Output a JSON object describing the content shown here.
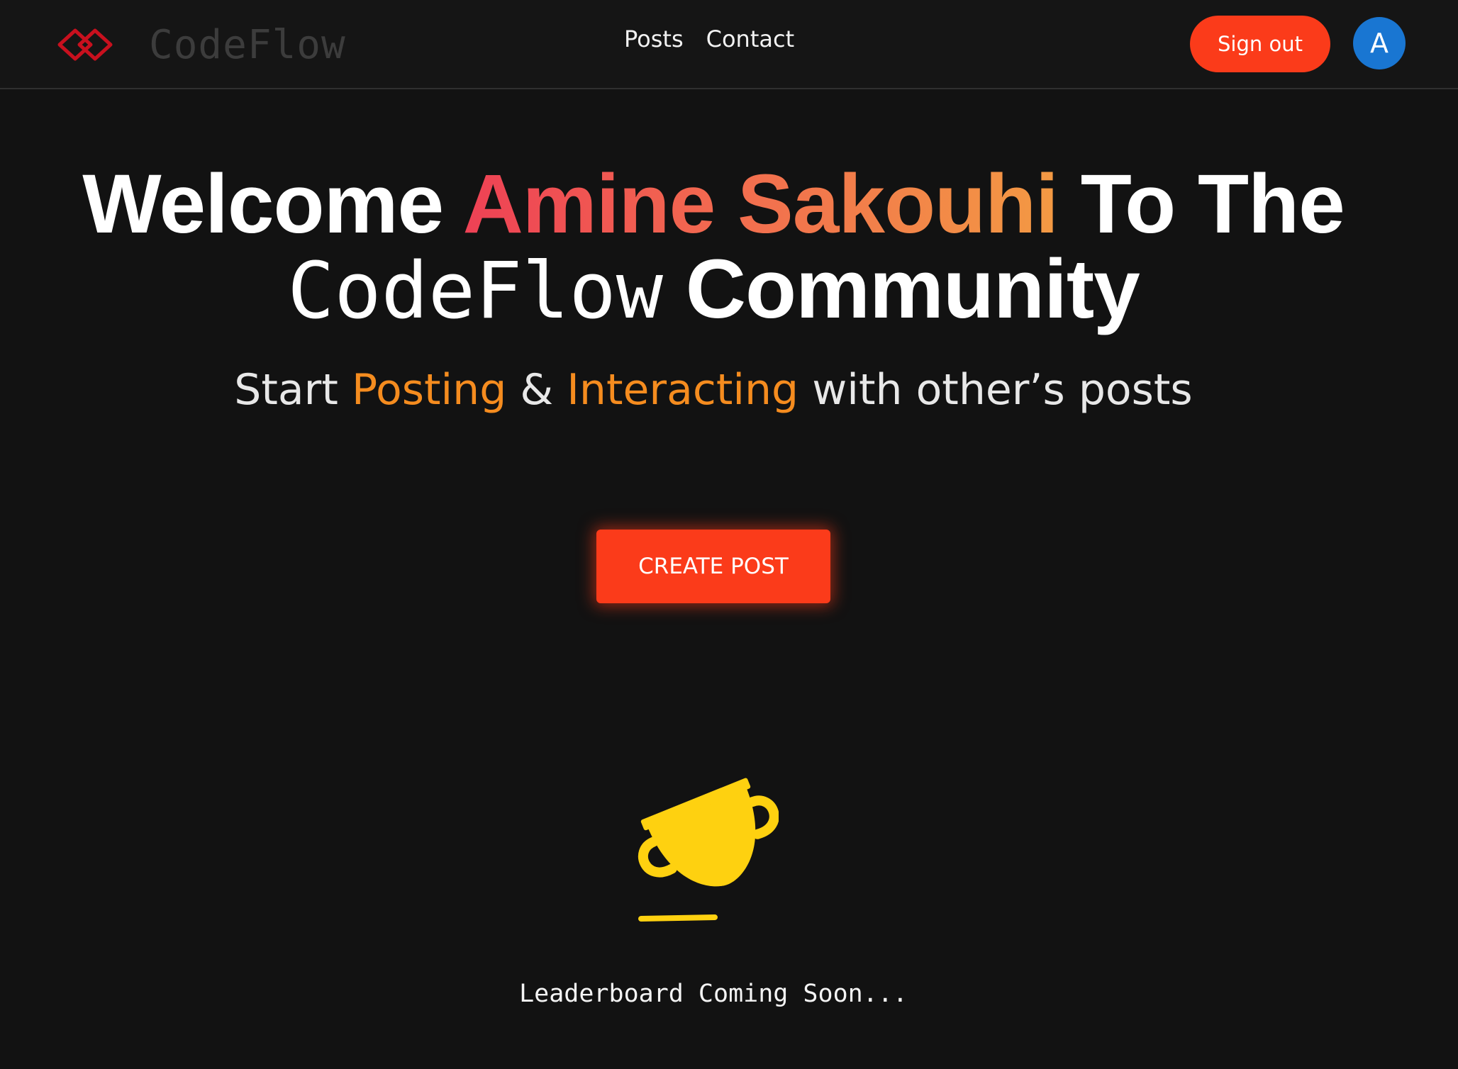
{
  "navbar": {
    "brand_name": "CodeFlow",
    "links": [
      {
        "label": "Posts"
      },
      {
        "label": "Contact"
      }
    ],
    "signout_label": "Sign out",
    "avatar_initial": "A"
  },
  "hero": {
    "welcome": "Welcome",
    "user_name": "Amine Sakouhi",
    "to_the": "To The",
    "the": "The",
    "brand": "CodeFlow",
    "community": "Community",
    "subtitle": {
      "start": "Start",
      "posting": "Posting",
      "amp": "&",
      "interacting": "Interacting",
      "rest": "with other’s posts"
    },
    "create_button": "CREATE POST"
  },
  "leaderboard": {
    "text": "Leaderboard Coming Soon...",
    "icon": "trophy-cup-icon"
  },
  "colors": {
    "background": "#121212",
    "accent": "#fb3b1a",
    "orange_text": "#f58c1f",
    "cup_yellow": "#fed110",
    "avatar_blue": "#1976d2"
  }
}
